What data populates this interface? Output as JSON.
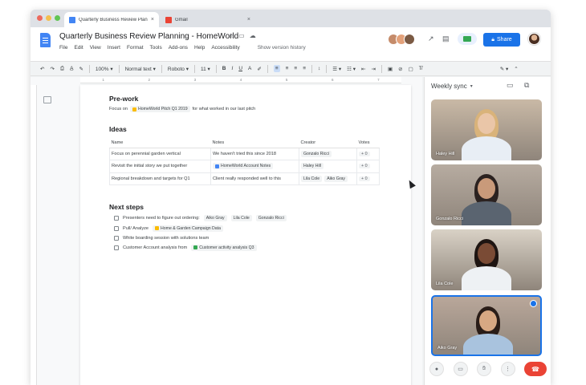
{
  "browser": {
    "tabs": [
      {
        "label": "Quarterly Business Review Plan",
        "icon_color": "#4285f4"
      },
      {
        "label": "Gmail",
        "icon_color": "#ea4335"
      }
    ],
    "close_glyph": "×"
  },
  "doc": {
    "title": "Quarterly Business Review Planning - HomeWorld",
    "menu": [
      "File",
      "Edit",
      "View",
      "Insert",
      "Format",
      "Tools",
      "Add-ons",
      "Help",
      "Accessibility"
    ],
    "version_history": "Show version history",
    "share_label": "Share"
  },
  "toolbar": {
    "zoom": "100%",
    "style": "Normal text",
    "font": "Roboto",
    "size": "11"
  },
  "ruler_ticks": [
    "1",
    "2",
    "3",
    "4",
    "5",
    "6",
    "7"
  ],
  "content": {
    "prework_heading": "Pre-work",
    "prework_prefix": "Focus on",
    "prework_chip": "HomeWorld Pitch Q1 2019",
    "prework_suffix": "for what worked in our last pitch",
    "ideas_heading": "Ideas",
    "ideas_columns": [
      "Name",
      "Notes",
      "Creator",
      "Votes"
    ],
    "ideas_rows": [
      {
        "name": "Focus on perennial garden vertical",
        "notes": "We haven't tried this since 2018",
        "creators": [
          "Gonzalo Ricci"
        ],
        "votes": "+ 0"
      },
      {
        "name": "Revisit the initial story we put together",
        "notes_chip": "HomeWorld Account Notes",
        "creators": [
          "Haley Hill"
        ],
        "votes": "+ 0"
      },
      {
        "name": "Regional breakdown and targets for Q1",
        "notes": "Client really responded well to this",
        "creators": [
          "Lila Cole",
          "Aiko Gray"
        ],
        "votes": "+ 0"
      }
    ],
    "next_heading": "Next steps",
    "next_steps": [
      {
        "text": "Presenters need to figure out ordering:",
        "people": [
          "Aiko Gray",
          "Lila Cole",
          "Gonzalo Ricci"
        ]
      },
      {
        "text": "Pull/ Analyze",
        "chip": "Home & Garden Campaign Data",
        "chip_color": "#fbbc04"
      },
      {
        "text": "White boarding session with solutions team"
      },
      {
        "text": "Customer Account analysis from",
        "chip": "Customer activity analysis Q3",
        "chip_color": "#34a853"
      }
    ]
  },
  "meet": {
    "title": "Weekly sync",
    "participants": [
      {
        "name": "Haley Hill",
        "bg": "#c9b9a6",
        "skin": "#eac6a8",
        "hair": "#d9b37a",
        "shirt": "#e8eef5"
      },
      {
        "name": "Gonzalo Ricci",
        "bg": "#b7aca1",
        "skin": "#c99a7a",
        "hair": "#2b2220",
        "shirt": "#5a6470"
      },
      {
        "name": "Lila Cole",
        "bg": "#d9d2c6",
        "skin": "#7a4b35",
        "hair": "#1e1512",
        "shirt": "#eef1f4"
      },
      {
        "name": "Aiko Gray",
        "bg": "#b9a79a",
        "skin": "#d7a883",
        "hair": "#2a1d18",
        "shirt": "#a9c3de"
      }
    ]
  }
}
